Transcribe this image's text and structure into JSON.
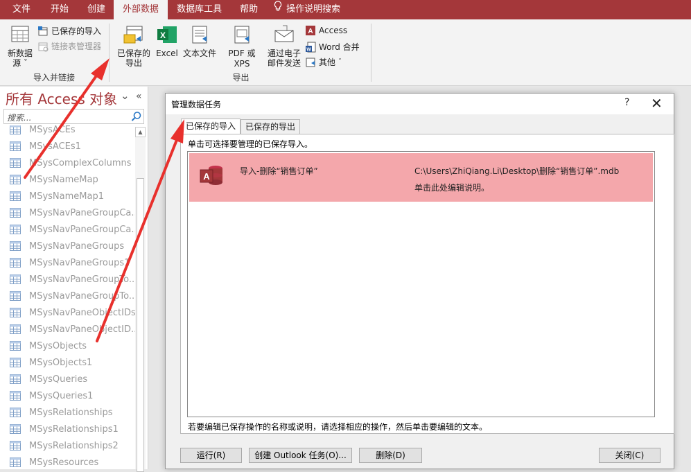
{
  "ribbon_tabs": [
    "文件",
    "开始",
    "创建",
    "外部数据",
    "数据库工具",
    "帮助",
    "操作说明搜索"
  ],
  "ribbon": {
    "import_group": {
      "new_source": "新数据\n源",
      "saved_imports": "已保存的导入",
      "linked_table_manager": "链接表管理器",
      "label": "导入并链接"
    },
    "export_group": {
      "saved_exports": "已保存的\n导出",
      "excel": "Excel",
      "text_file": "文本文件",
      "pdf_xps": "PDF 或 XPS",
      "email": "通过电子\n邮件发送",
      "access": "Access",
      "word_merge": "Word 合并",
      "other": "其他",
      "label": "导出"
    }
  },
  "nav": {
    "title": "所有 Access 对象",
    "search_placeholder": "搜索...",
    "items": [
      "MSysACEs",
      "MSysACEs1",
      "MSysComplexColumns",
      "MSysNameMap",
      "MSysNameMap1",
      "MSysNavPaneGroupCa...",
      "MSysNavPaneGroupCa...",
      "MSysNavPaneGroups",
      "MSysNavPaneGroups1",
      "MSysNavPaneGroupTo...",
      "MSysNavPaneGroupTo...",
      "MSysNavPaneObjectIDs",
      "MSysNavPaneObjectID...",
      "MSysObjects",
      "MSysObjects1",
      "MSysQueries",
      "MSysQueries1",
      "MSysRelationships",
      "MSysRelationships1",
      "MSysRelationships2",
      "MSysResources"
    ]
  },
  "dialog": {
    "title": "管理数据任务",
    "help": "?",
    "close": "✕",
    "tabs": [
      "已保存的导入",
      "已保存的导出"
    ],
    "hint": "单击可选择要管理的已保存导入。",
    "row": {
      "name": "导入-删除“销售订单”",
      "path": "C:\\Users\\ZhiQiang.Li\\Desktop\\删除“销售订单”.mdb",
      "description": "单击此处编辑说明。"
    },
    "footer_hint": "若要编辑已保存操作的名称或说明，请选择相应的操作，然后单击要编辑的文本。",
    "buttons": {
      "run": "运行(R)",
      "create_outlook": "创建 Outlook 任务(O)...",
      "delete": "删除(D)",
      "close": "关闭(C)"
    }
  },
  "colors": {
    "accent": "#a4373a",
    "selected_row": "#f4a7ab",
    "arrow": "#e8302c"
  }
}
